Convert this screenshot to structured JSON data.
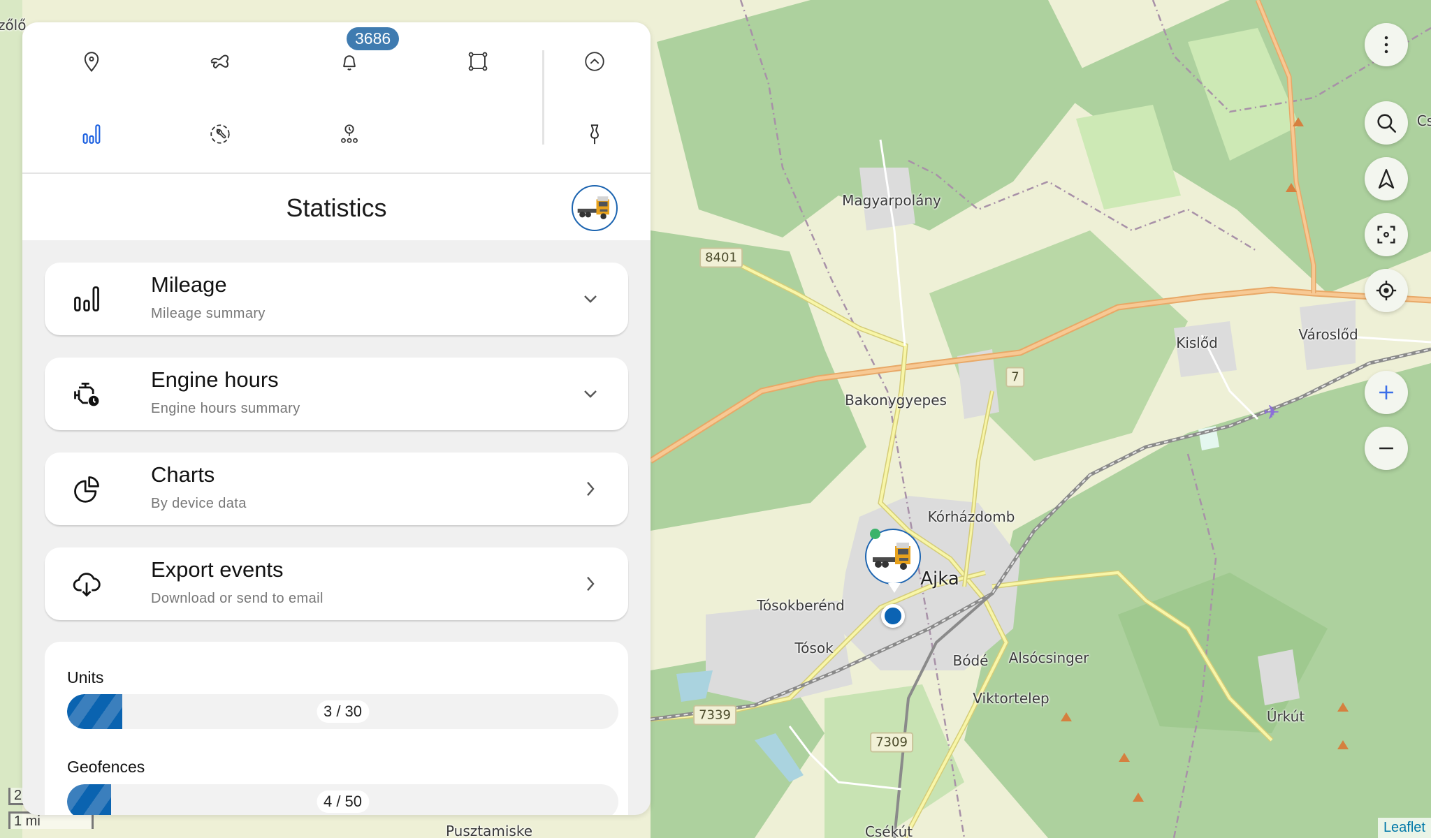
{
  "panel": {
    "toolbar": {
      "items": [
        {
          "id": "locations",
          "icon": "map-pin-icon"
        },
        {
          "id": "tracks",
          "icon": "route-icon"
        },
        {
          "id": "notifications",
          "icon": "bell-icon",
          "badge": "3686"
        },
        {
          "id": "geofences",
          "icon": "geofence-polygon-icon"
        },
        {
          "id": "statistics",
          "icon": "bar-chart-icon",
          "active": true
        },
        {
          "id": "maintenance",
          "icon": "wrench-circle-icon"
        },
        {
          "id": "tasks",
          "icon": "clock-nodes-icon"
        }
      ],
      "collapse_icon": "chevron-up-circle-icon",
      "pin_icon": "pin-icon",
      "active_color": "#1a5fe0"
    },
    "header": {
      "title": "Statistics",
      "unit_icon": "truck-avatar"
    },
    "cards": [
      {
        "title": "Mileage",
        "subtitle": "Mileage summary",
        "icon": "bar-chart-icon",
        "action": "chevron-down-icon"
      },
      {
        "title": "Engine hours",
        "subtitle": "Engine hours summary",
        "icon": "engine-clock-icon",
        "action": "chevron-down-icon"
      },
      {
        "title": "Charts",
        "subtitle": "By device data",
        "icon": "pie-chart-icon",
        "action": "chevron-right-icon"
      },
      {
        "title": "Export events",
        "subtitle": "Download or send to email",
        "icon": "cloud-download-icon",
        "action": "chevron-right-icon"
      }
    ],
    "usage": [
      {
        "label": "Units",
        "used": 3,
        "limit": 30,
        "text": "3 / 30"
      },
      {
        "label": "Geofences",
        "used": 4,
        "limit": 50,
        "text": "4 / 50"
      }
    ]
  },
  "map": {
    "controls": [
      "more-vertical-icon",
      "search-icon",
      "navigation-arrow-icon",
      "focus-frame-icon",
      "locate-crosshair-icon",
      "zoom-in-icon",
      "zoom-out-icon"
    ],
    "labels": [
      {
        "text": "Magyarpolány"
      },
      {
        "text": "Bakonygyepes"
      },
      {
        "text": "Kislőd"
      },
      {
        "text": "Városlőd"
      },
      {
        "text": "Kórházdomb"
      },
      {
        "text": "Ajka"
      },
      {
        "text": "Tósokberénd"
      },
      {
        "text": "Tósok"
      },
      {
        "text": "Bódé"
      },
      {
        "text": "Alsócsinger"
      },
      {
        "text": "Viktortelep"
      },
      {
        "text": "Úrkút"
      },
      {
        "text": "Csékút"
      },
      {
        "text": "Pusztamiske"
      },
      {
        "text": "Cs"
      },
      {
        "text": "szőlő"
      }
    ],
    "road_shields": [
      "8401",
      "7",
      "7339",
      "7309"
    ],
    "scale": {
      "metric": "2",
      "imperial": "1 mi"
    },
    "attribution": "Leaflet"
  }
}
